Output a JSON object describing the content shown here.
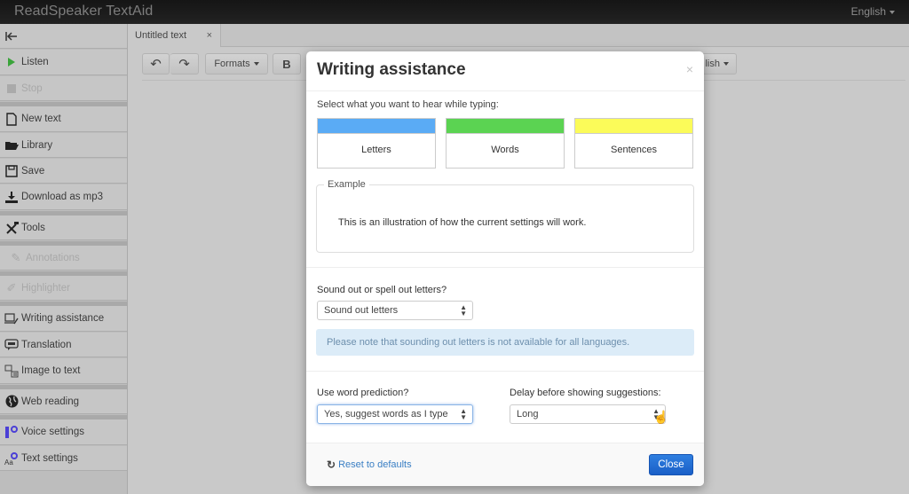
{
  "app": {
    "title": "ReadSpeaker TextAid",
    "language": "English"
  },
  "sidebar": {
    "collapse_icon": "collapse-left-icon",
    "items": [
      {
        "label": "Listen",
        "icon": "play-icon",
        "enabled": true
      },
      {
        "label": "Stop",
        "icon": "stop-icon",
        "enabled": false
      },
      {
        "label": "New text",
        "icon": "file-icon",
        "enabled": true
      },
      {
        "label": "Library",
        "icon": "folder-icon",
        "enabled": true
      },
      {
        "label": "Save",
        "icon": "floppy-icon",
        "enabled": true
      },
      {
        "label": "Download as mp3",
        "icon": "download-icon",
        "enabled": true
      },
      {
        "label": "Tools",
        "icon": "tools-icon",
        "enabled": true
      },
      {
        "label": "Annotations",
        "icon": "annotation-icon",
        "enabled": false
      },
      {
        "label": "Highlighter",
        "icon": "highlighter-icon",
        "enabled": false
      },
      {
        "label": "Writing assistance",
        "icon": "writing-assistance-icon",
        "enabled": true
      },
      {
        "label": "Translation",
        "icon": "translation-icon",
        "enabled": true
      },
      {
        "label": "Image to text",
        "icon": "image-to-text-icon",
        "enabled": true
      },
      {
        "label": "Web reading",
        "icon": "globe-icon",
        "enabled": true
      },
      {
        "label": "Voice settings",
        "icon": "voice-settings-icon",
        "enabled": true
      },
      {
        "label": "Text settings",
        "icon": "text-settings-icon",
        "enabled": true
      }
    ]
  },
  "editor": {
    "tab_label": "Untitled text",
    "tab_close": "×",
    "toolbar": {
      "undo_icon": "↶",
      "redo_icon": "↷",
      "formats_label": "Formats",
      "bold_label": "B",
      "language_label": "lish"
    }
  },
  "modal": {
    "title": "Writing assistance",
    "close": "×",
    "select_prompt": "Select what you want to hear while typing:",
    "modes": [
      {
        "label": "Letters",
        "color": "#5aabf5"
      },
      {
        "label": "Words",
        "color": "#5bd352"
      },
      {
        "label": "Sentences",
        "color": "#fbfb59"
      }
    ],
    "example": {
      "legend": "Example",
      "text": "This is an illustration of how the current settings will work."
    },
    "sound_out": {
      "label": "Sound out or spell out letters?",
      "value": "Sound out letters"
    },
    "note": "Please note that sounding out letters is not available for all languages.",
    "word_prediction": {
      "label": "Use word prediction?",
      "value": "Yes, suggest words as I type"
    },
    "delay": {
      "label": "Delay before showing suggestions:",
      "value": "Long"
    },
    "footer": {
      "reset_label": "Reset to defaults",
      "close_label": "Close"
    }
  }
}
